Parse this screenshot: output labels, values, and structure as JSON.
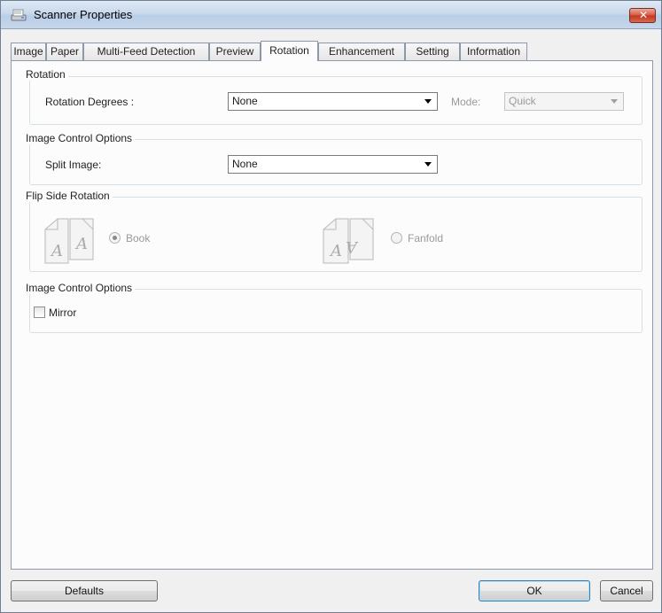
{
  "window": {
    "title": "Scanner Properties"
  },
  "tabs": [
    {
      "label": "Image"
    },
    {
      "label": "Paper"
    },
    {
      "label": "Multi-Feed Detection"
    },
    {
      "label": "Preview"
    },
    {
      "label": "Rotation"
    },
    {
      "label": "Enhancement"
    },
    {
      "label": "Setting"
    },
    {
      "label": "Information"
    }
  ],
  "active_tab": "Rotation",
  "rotation": {
    "group_label": "Rotation",
    "degrees_label": "Rotation Degrees :",
    "degrees_value": "None",
    "mode_label": "Mode:",
    "mode_value": "Quick"
  },
  "image_control": {
    "group_label": "Image Control Options",
    "split_label": "Split Image:",
    "split_value": "None"
  },
  "flip_side": {
    "group_label": "Flip Side Rotation",
    "book_label": "Book",
    "fanfold_label": "Fanfold",
    "selected": "Book"
  },
  "image_control_2": {
    "group_label": "Image Control Options",
    "mirror_label": "Mirror",
    "mirror_checked": false
  },
  "buttons": {
    "defaults": "Defaults",
    "ok": "OK",
    "cancel": "Cancel"
  }
}
